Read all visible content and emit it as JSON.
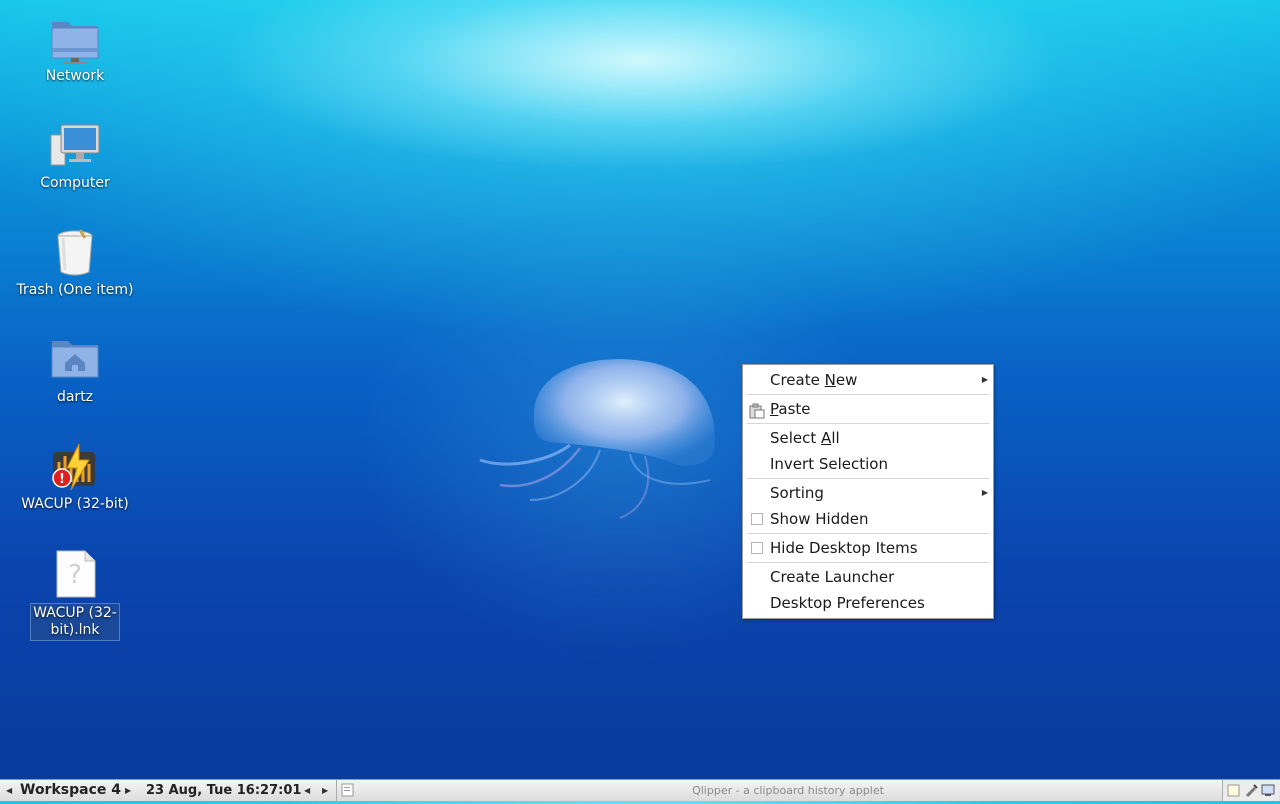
{
  "desktop": {
    "icons": [
      {
        "label": "Network",
        "icon": "network-folder-icon"
      },
      {
        "label": "Computer",
        "icon": "computer-icon"
      },
      {
        "label": "Trash (One item)",
        "icon": "trash-icon"
      },
      {
        "label": "dartz",
        "icon": "home-folder-icon"
      },
      {
        "label": "WACUP (32-bit)",
        "icon": "wacup-icon"
      },
      {
        "label": "WACUP (32-bit).lnk",
        "icon": "unknown-file-icon"
      }
    ]
  },
  "context_menu": {
    "create_new": {
      "pre": "Create ",
      "mn": "N",
      "post": "ew"
    },
    "paste": {
      "pre": "",
      "mn": "P",
      "post": "aste"
    },
    "select_all": {
      "pre": "Select ",
      "mn": "A",
      "post": "ll"
    },
    "invert_selection": "Invert Selection",
    "sorting": "Sorting",
    "show_hidden": "Show Hidden",
    "hide_desktop_items": "Hide Desktop Items",
    "create_launcher": "Create Launcher",
    "desktop_preferences": "Desktop Preferences"
  },
  "taskbar": {
    "workspace": "Workspace 4",
    "clock": "23 Aug, Tue 16:27:01",
    "tooltip": "Qlipper - a clipboard history applet"
  },
  "colors": {
    "menu_bg": "#ffffff",
    "taskbar_bg": "#e6e6e6",
    "desktop_top": "#18c8ea",
    "desktop_bottom": "#0a3a9c"
  }
}
